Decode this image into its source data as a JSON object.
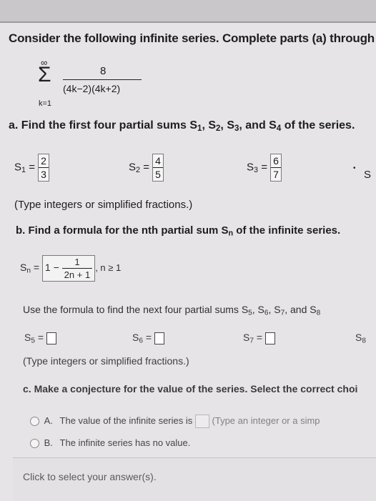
{
  "header": {
    "instruction": "Consider the following infinite series. Complete parts (a) through (c"
  },
  "series": {
    "upper": "∞",
    "sigma": "Σ",
    "lower": "k=1",
    "numerator": "8",
    "denominator": "(4k−2)(4k+2)"
  },
  "part_a": {
    "prompt_prefix": "a. Find the first four partial sums S",
    "prompt_suffix": " of the series.",
    "subscripts": [
      "1",
      "2",
      "3",
      "4"
    ],
    "sums": [
      {
        "label": "S",
        "sub": "1",
        "num": "2",
        "den": "3"
      },
      {
        "label": "S",
        "sub": "2",
        "num": "4",
        "den": "5"
      },
      {
        "label": "S",
        "sub": "3",
        "num": "6",
        "den": "7"
      }
    ],
    "s4_label": "S",
    "note": "(Type integers or simplified fractions.)"
  },
  "part_b": {
    "prompt": "b. Find a formula for the nth partial sum S",
    "prompt_sub": "n",
    "prompt_suffix": " of the infinite series.",
    "formula_label": "S",
    "formula_sub": "n",
    "formula_whole": "1 −",
    "formula_num": "1",
    "formula_den": "2n + 1",
    "condition": ", n ≥ 1",
    "next_prompt": "Use the formula to find the next four partial sums S",
    "next_subs": [
      "5",
      "6",
      "7",
      "8"
    ],
    "next_sums": [
      {
        "label": "S",
        "sub": "5"
      },
      {
        "label": "S",
        "sub": "6"
      },
      {
        "label": "S",
        "sub": "7"
      },
      {
        "label": "S",
        "sub": "8"
      }
    ],
    "note": "(Type integers or simplified fractions.)"
  },
  "part_c": {
    "prompt": "c. Make a conjecture for the value of the series. Select the correct choi",
    "options": [
      {
        "letter": "A.",
        "text": "The value of the infinite series is",
        "hint": "(Type an integer or a simp"
      },
      {
        "letter": "B.",
        "text": "The infinite series has no value."
      }
    ]
  },
  "footer": {
    "status": "Click to select your answer(s)."
  }
}
